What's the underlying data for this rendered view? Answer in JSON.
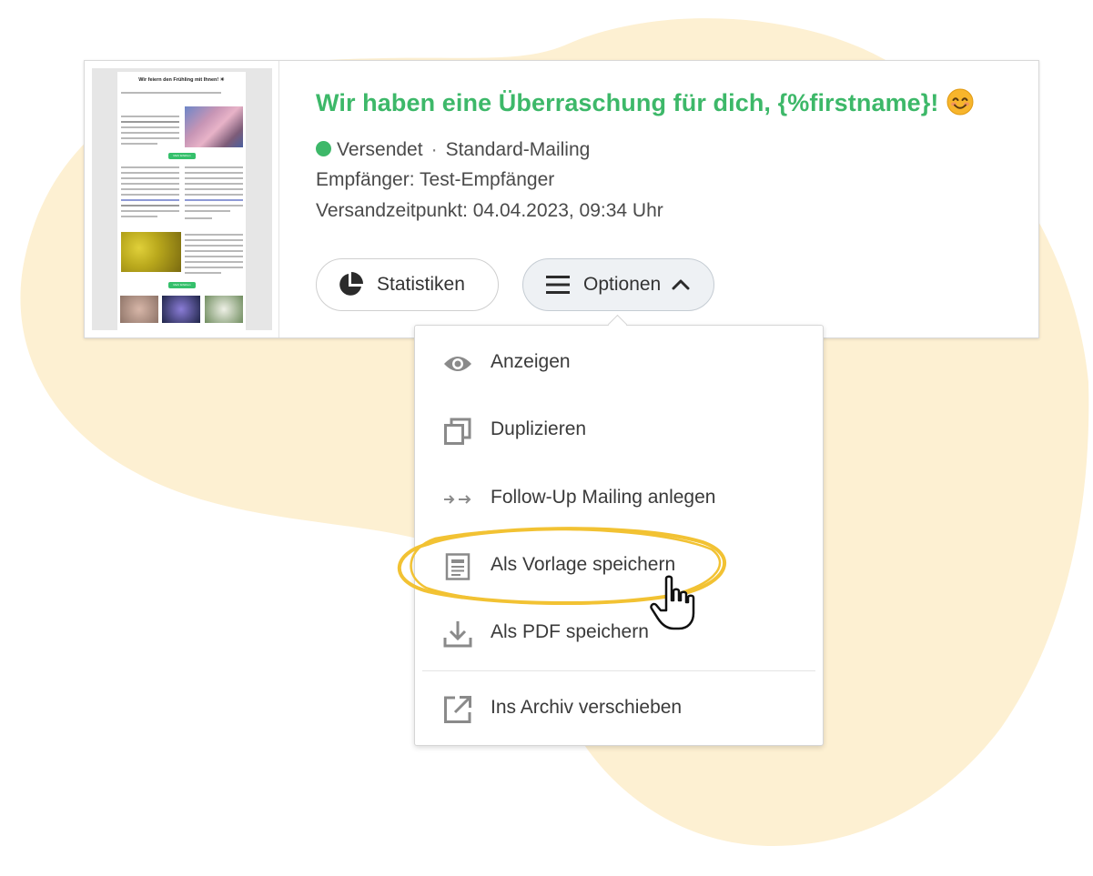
{
  "colors": {
    "accent_green": "#3db869",
    "background_blob": "#fdf0d2",
    "highlight": "#f2c233"
  },
  "thumbnail": {
    "title": "Wir feiern den Frühling mit Ihnen! ☀",
    "button_label": "Mehr Erfahren"
  },
  "mailing": {
    "subject": "Wir haben eine Überraschung für dich, {%firstname}!",
    "subject_icon": "smiling-face-emoji",
    "status": "Versendet",
    "separator": "·",
    "type": "Standard-Mailing",
    "recipients": "Empfänger: Test-Empfänger",
    "send_time": "Versandzeitpunkt: 04.04.2023, 09:34 Uhr"
  },
  "buttons": {
    "statistics": "Statistiken",
    "statistics_icon": "pie-chart-icon",
    "options": "Optionen",
    "options_icon": "hamburger-menu-icon",
    "options_chevron": "chevron-up-icon"
  },
  "menu": {
    "items": [
      {
        "label": "Anzeigen",
        "icon": "eye-icon"
      },
      {
        "label": "Duplizieren",
        "icon": "duplicate-icon"
      },
      {
        "label": "Follow-Up Mailing anlegen",
        "icon": "follow-up-arrows-icon"
      },
      {
        "label": "Als Vorlage speichern",
        "icon": "template-icon"
      },
      {
        "label": "Als PDF speichern",
        "icon": "download-icon"
      },
      {
        "label": "Ins Archiv verschieben",
        "icon": "external-link-icon"
      }
    ]
  }
}
